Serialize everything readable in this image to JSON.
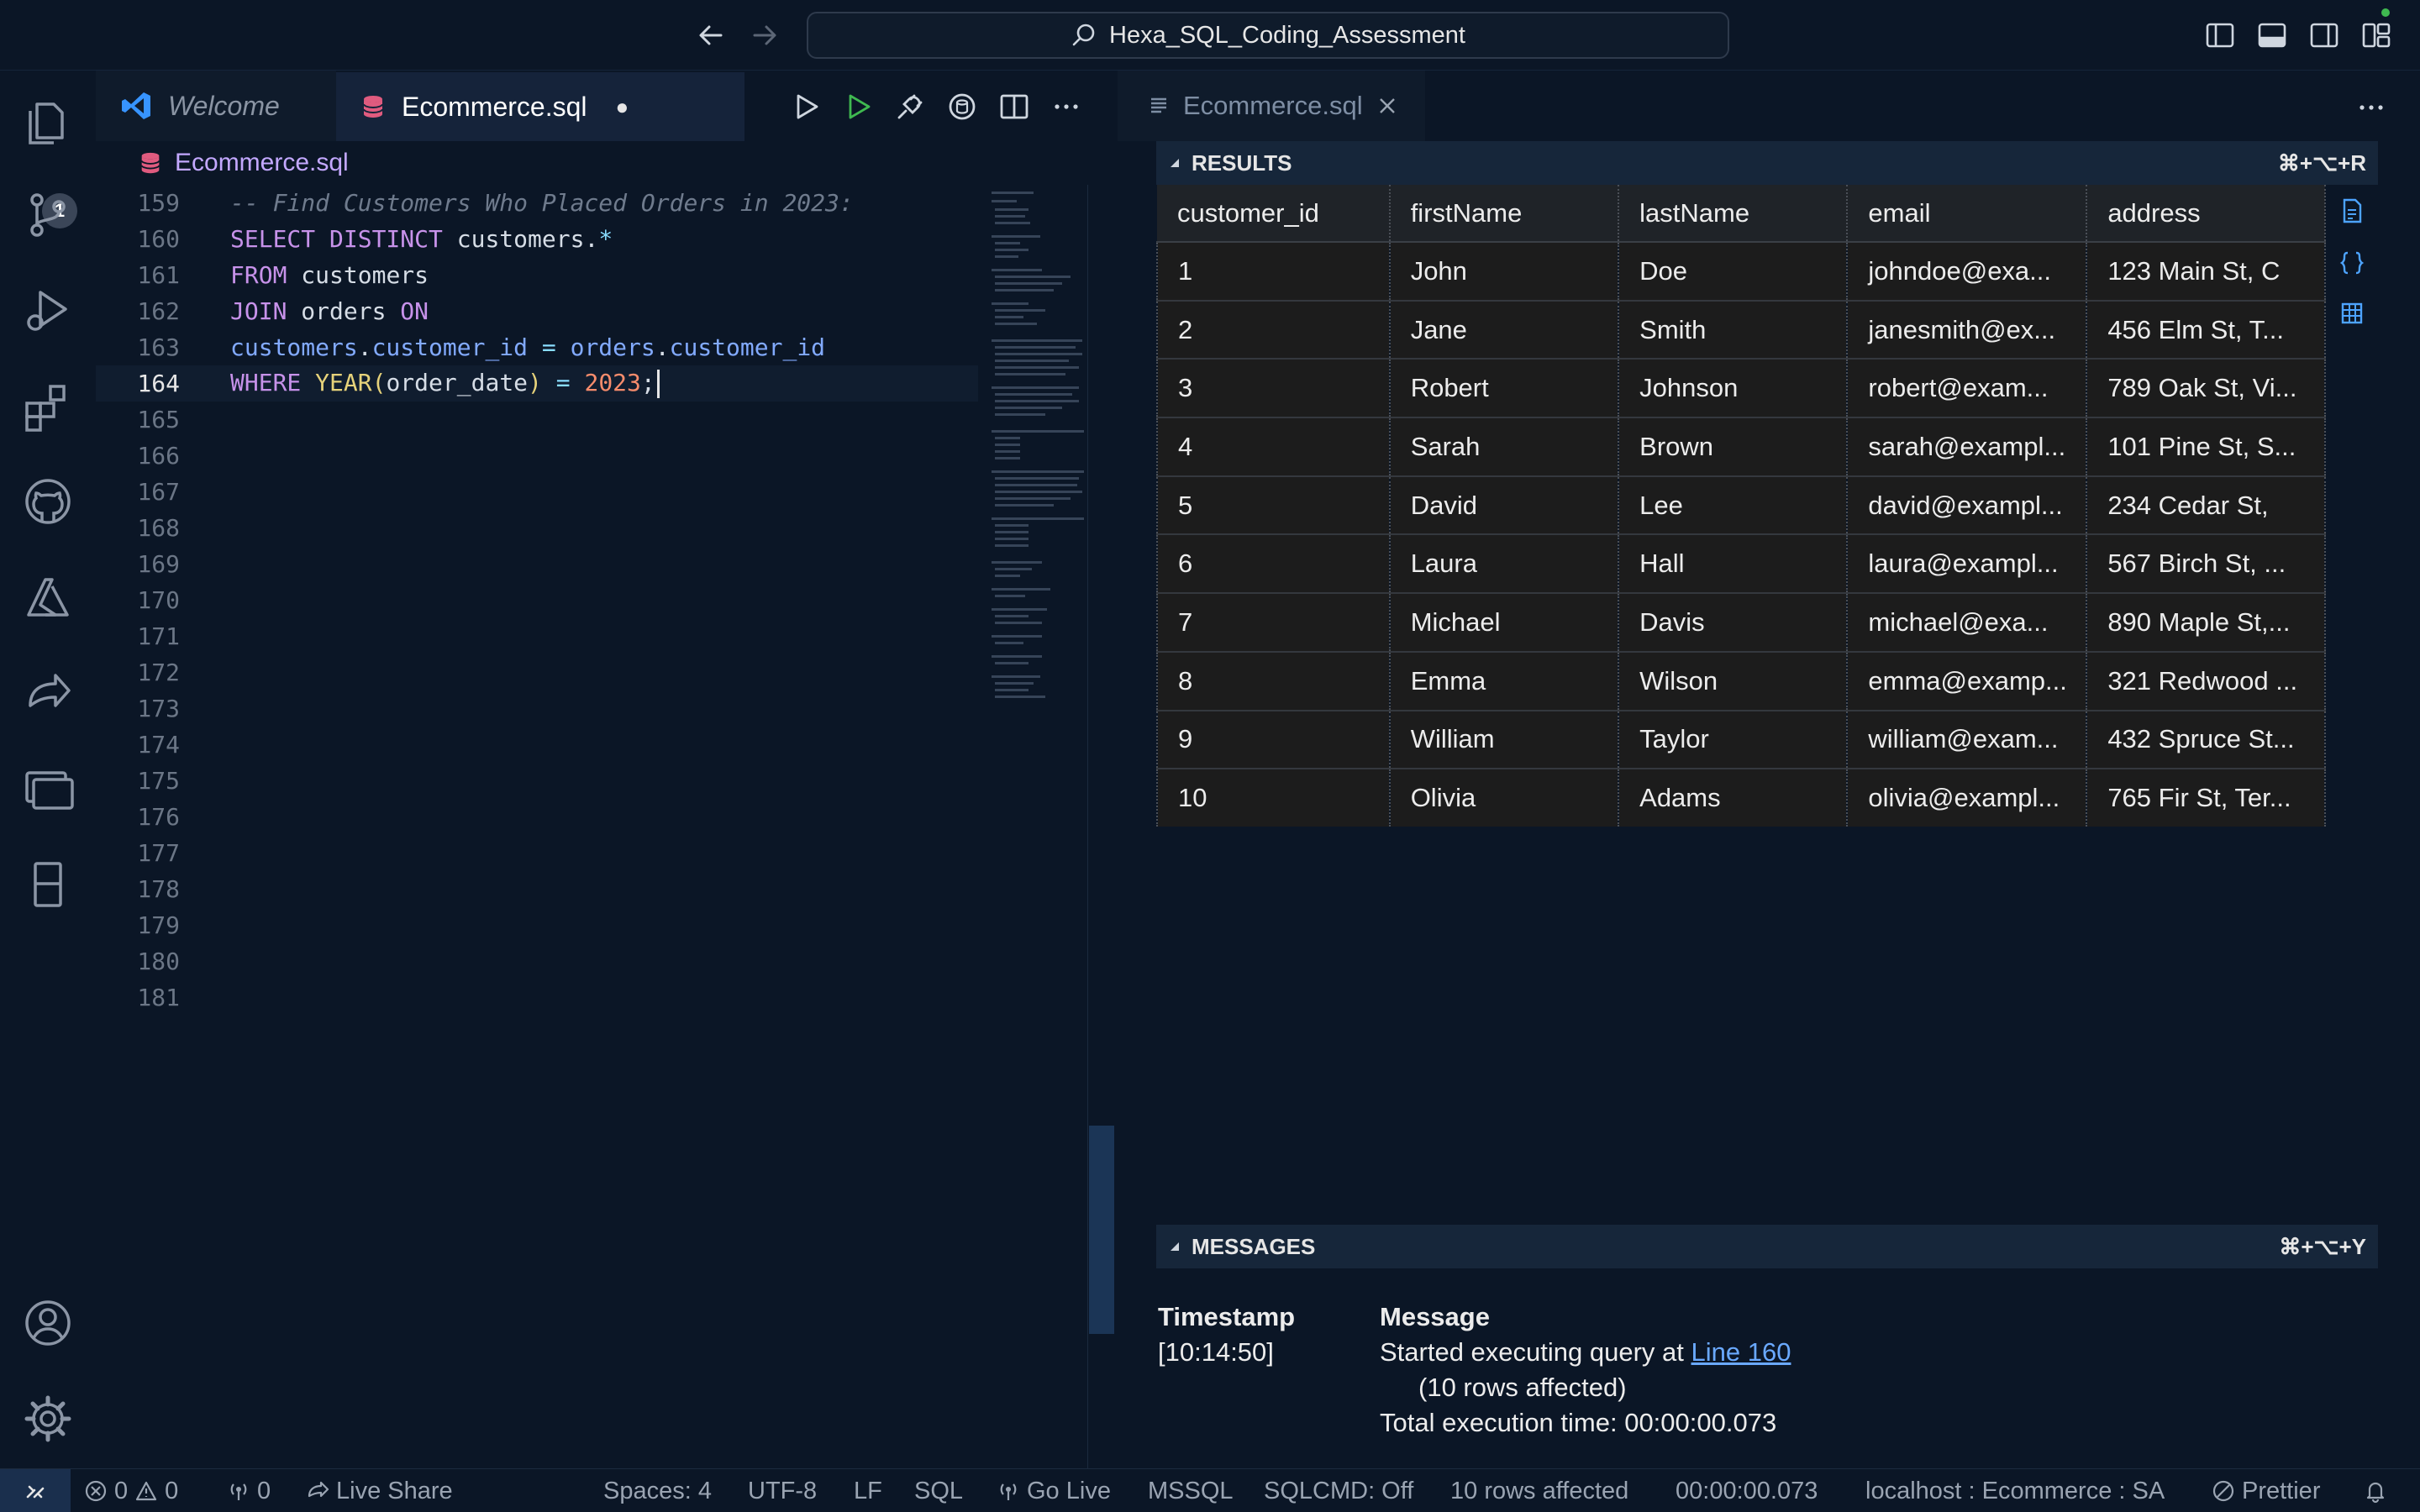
{
  "window": {
    "title": "Hexa_SQL_Coding_Assessment"
  },
  "activity_bar": {
    "explorer_badge": "1"
  },
  "editor": {
    "tabs": [
      {
        "label": "Welcome"
      },
      {
        "label": "Ecommerce.sql",
        "modified_indicator": "●"
      }
    ],
    "breadcrumb": "Ecommerce.sql",
    "lines": [
      {
        "num": "159",
        "comment": "-- Find Customers Who Placed Orders in 2023:"
      },
      {
        "num": "160",
        "kw1": "SELECT DISTINCT",
        "rest": " customers.",
        "star": "*"
      },
      {
        "num": "161",
        "kw1": "FROM",
        "rest": " customers"
      },
      {
        "num": "162",
        "kw1": "JOIN",
        "rest": " orders ",
        "kw2": "ON"
      },
      {
        "num": "163",
        "id1": "customers",
        "dot1": ".",
        "id2": "customer_id",
        "eq": " = ",
        "id3": "orders",
        "dot2": ".",
        "id4": "customer_id"
      },
      {
        "num": "164",
        "kw1": "WHERE",
        "fn": "YEAR",
        "p1": "(",
        "arg": "order_date",
        "p2": ")",
        "eq": " = ",
        "numval": "2023",
        "semi": ";"
      },
      {
        "num": "165"
      },
      {
        "num": "166"
      },
      {
        "num": "167"
      },
      {
        "num": "168"
      },
      {
        "num": "169"
      },
      {
        "num": "170"
      },
      {
        "num": "171"
      },
      {
        "num": "172"
      },
      {
        "num": "173"
      },
      {
        "num": "174"
      },
      {
        "num": "175"
      },
      {
        "num": "176"
      },
      {
        "num": "177"
      },
      {
        "num": "178"
      },
      {
        "num": "179"
      },
      {
        "num": "180"
      },
      {
        "num": "181"
      }
    ]
  },
  "results_panel": {
    "tab_label": "Ecommerce.sql",
    "results_title": "RESULTS",
    "results_shortcut": "⌘+⌥+R",
    "columns": [
      "customer_id",
      "firstName",
      "lastName",
      "email",
      "address"
    ],
    "rows": [
      [
        "1",
        "John",
        "Doe",
        "johndoe@exa...",
        "123 Main St, C"
      ],
      [
        "2",
        "Jane",
        "Smith",
        "janesmith@ex...",
        "456 Elm St, T..."
      ],
      [
        "3",
        "Robert",
        "Johnson",
        "robert@exam...",
        "789 Oak St, Vi..."
      ],
      [
        "4",
        "Sarah",
        "Brown",
        "sarah@exampl...",
        "101 Pine St, S..."
      ],
      [
        "5",
        "David",
        "Lee",
        "david@exampl...",
        "234 Cedar St,"
      ],
      [
        "6",
        "Laura",
        "Hall",
        "laura@exampl...",
        "567 Birch St, ..."
      ],
      [
        "7",
        "Michael",
        "Davis",
        "michael@exa...",
        "890 Maple St,..."
      ],
      [
        "8",
        "Emma",
        "Wilson",
        "emma@examp...",
        "321 Redwood ..."
      ],
      [
        "9",
        "William",
        "Taylor",
        "william@exam...",
        "432 Spruce St..."
      ],
      [
        "10",
        "Olivia",
        "Adams",
        "olivia@exampl...",
        "765 Fir St, Ter..."
      ]
    ],
    "messages_title": "MESSAGES",
    "messages_shortcut": "⌘+⌥+Y",
    "messages": {
      "timestamp_header": "Timestamp",
      "message_header": "Message",
      "timestamp": "[10:14:50]",
      "line1_prefix": "Started executing query at ",
      "line1_link": "Line 160",
      "line2": "(10 rows affected)",
      "line3": "Total execution time: 00:00:00.073"
    }
  },
  "status_bar": {
    "errors": "0",
    "warnings": "0",
    "ports": "0",
    "live_share": "Live Share",
    "spaces": "Spaces: 4",
    "encoding": "UTF-8",
    "eol": "LF",
    "language": "SQL",
    "go_live": "Go Live",
    "mssql": "MSSQL",
    "sqlcmd": "SQLCMD: Off",
    "rows_affected": "10 rows affected",
    "exec_time": "00:00:00.073",
    "connection": "localhost : Ecommerce : SA",
    "prettier": "Prettier"
  },
  "colors": {
    "accent": "#3794ff",
    "background": "#0b1626",
    "keyword": "#c792ea",
    "number": "#f78c6c"
  }
}
